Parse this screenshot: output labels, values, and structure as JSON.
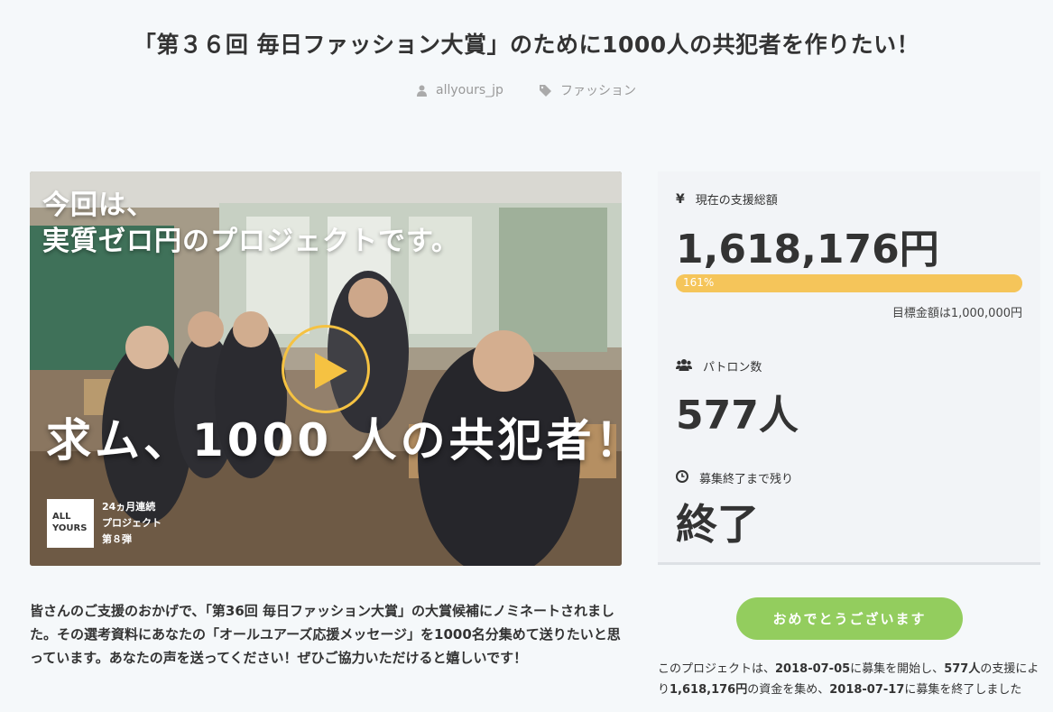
{
  "page": {
    "title": "「第３６回 毎日ファッション大賞」のために1000人の共犯者を作りたい！",
    "author": "allyours_jp",
    "category": "ファッション"
  },
  "hero": {
    "line1": "今回は、",
    "line2": "実質ゼロ円のプロジェクトです。",
    "big_text": "求ム、1000 人の共犯者！",
    "logo_line1": "ALL",
    "logo_line2": "YOURS",
    "caption_line1": "24ヵ月連続",
    "caption_line2": "プロジェクト",
    "caption_line3": "第８弾"
  },
  "description": "皆さんのご支援のおかげで、「第36回 毎日ファッション大賞」の大賞候補にノミネートされました。その選考資料にあなたの「オールユアーズ応援メッセージ」を1000名分集めて送りたいと思っています。あなたの声を送ってください！ぜひご協力いただけると嬉しいです！",
  "stats": {
    "amount_label": "現在の支援総額",
    "amount_value": "1,618,176円",
    "progress_text": "161%",
    "progress_fraction": 1.0,
    "goal_text": "目標金額は1,000,000円",
    "patrons_label": "パトロン数",
    "patrons_value": "577人",
    "remaining_label": "募集終了まで残り",
    "remaining_value": "終了"
  },
  "congrats_button": "おめでとうございます",
  "summary": {
    "p1": "このプロジェクトは、",
    "start_date": "2018-07-05",
    "p2": "に募集を開始し、",
    "patrons": "577人",
    "p3": "の支援により",
    "amount": "1,618,176円",
    "p4": "の資金を集め、",
    "end_date": "2018-07-17",
    "p5": "に募集を終了しました"
  },
  "colors": {
    "progress": "#f5c55a",
    "button": "#93cd5e",
    "play_ring": "#f5c242"
  },
  "icons": {
    "author": "user-icon",
    "category": "tag-icon",
    "amount": "yen-icon",
    "patrons": "users-icon",
    "remaining": "clock-icon"
  }
}
